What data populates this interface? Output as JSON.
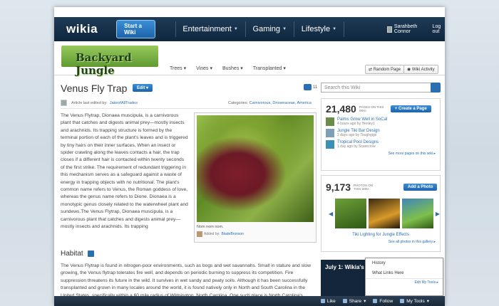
{
  "topnav": {
    "logo": "wikia",
    "start_wiki": "Start a Wiki",
    "links": [
      "Entertainment",
      "Gaming",
      "Lifestyle"
    ],
    "user": "Sarahbeth Connor",
    "logout": "Log out"
  },
  "wiki": {
    "wordmark": "Backyard Jungle",
    "nav": [
      "Trees",
      "Vines",
      "Bushes",
      "Transplanted"
    ],
    "random_page": "Random Page",
    "wiki_activity": "Wiki Activity"
  },
  "article": {
    "title": "Venus Fly Trap",
    "edit": "Edit",
    "comment_count": "11",
    "last_edited_prefix": "Article last edited by:",
    "last_edited_user": "JakeofAllTrades",
    "categories_label": "Categories:",
    "categories": "Carnivorous, Droseraceae, America",
    "paragraph1": "The Venus Flytrap, Dionaea muscipula, is a carnivorous plant that catches and digests animal prey—mostly insects and arachnids. Its trapping structure is formed by the terminal portion of each of the plant's leaves and is triggered by tiny hairs on their inner surfaces. When an insect or spider crawling along the leaves contacts a hair, the trap closes if a different hair is contacted within twenty seconds of the first strike. The requirement of redundant triggering in this mechanism serves as a safeguard against a waste of energy in trapping objects with no nutritional. The plant's common name refers to Venus, the Roman goddess of love, whereas the genus name refers to Dione. Dionaea is a monotypic genus closely related to the waterwheel plant and sundews.The Venus Flytrap, Dionaea muscipula, is a carnivorous plant that catches and digests animal prey—mostly insects and arachnids. Its trapping",
    "photo_caption": "Nom nom nom.",
    "photo_added_prefix": "Added by:",
    "photo_added_user": "BladeBronson",
    "habitat_heading": "Habitat",
    "paragraph2": "The Venus Flytrap is found in nitrogen-poor environments, such as bogs and wet savannahs. Small in stature and slow growing, the Venus flytrap tolerates fire well, and depends on periodic burning to suppress its competition. Fire suppression threatens its future in the wild. It survives in wet sandy and peaty soils. Although it has been successfully transplanted and grown in many locales around the world, it is found natively only in North and South Carolina in the United States, specifically within a 60 mile radius of Wilmington, North Carolina. One such place is North Carolina's"
  },
  "rail": {
    "search_placeholder": "Search this Wiki",
    "pages_count": "21,480",
    "pages_label": "PAGES ON THIS WIKI",
    "create_page": "Create a Page",
    "activity": [
      {
        "title": "Palms Grow Well in SoCal",
        "meta": "4 hours ago by Henley1"
      },
      {
        "title": "Jungle Tiki Bar Design",
        "meta": "2 days ago by Toughgigs"
      },
      {
        "title": "Tropical Pool Designs",
        "meta": "1 day ago by Scarecrow"
      }
    ],
    "see_more": "See more pages on this wiki",
    "photos_count": "9,173",
    "photos_label": "PHOTOS ON THIS WIKI",
    "add_photo": "Add a Photo",
    "slide_title": "Tiki Lighting for Jungle Effects",
    "see_gallery": "See all photos in this gallery",
    "dark_title": "July 1: Wikia's M"
  },
  "toolbar": {
    "like": "Like",
    "share": "Share",
    "follow": "Follow",
    "mytools": "My Tools",
    "menu": [
      "History",
      "What Links Here"
    ],
    "edit_tools": "Edit My Tools"
  }
}
